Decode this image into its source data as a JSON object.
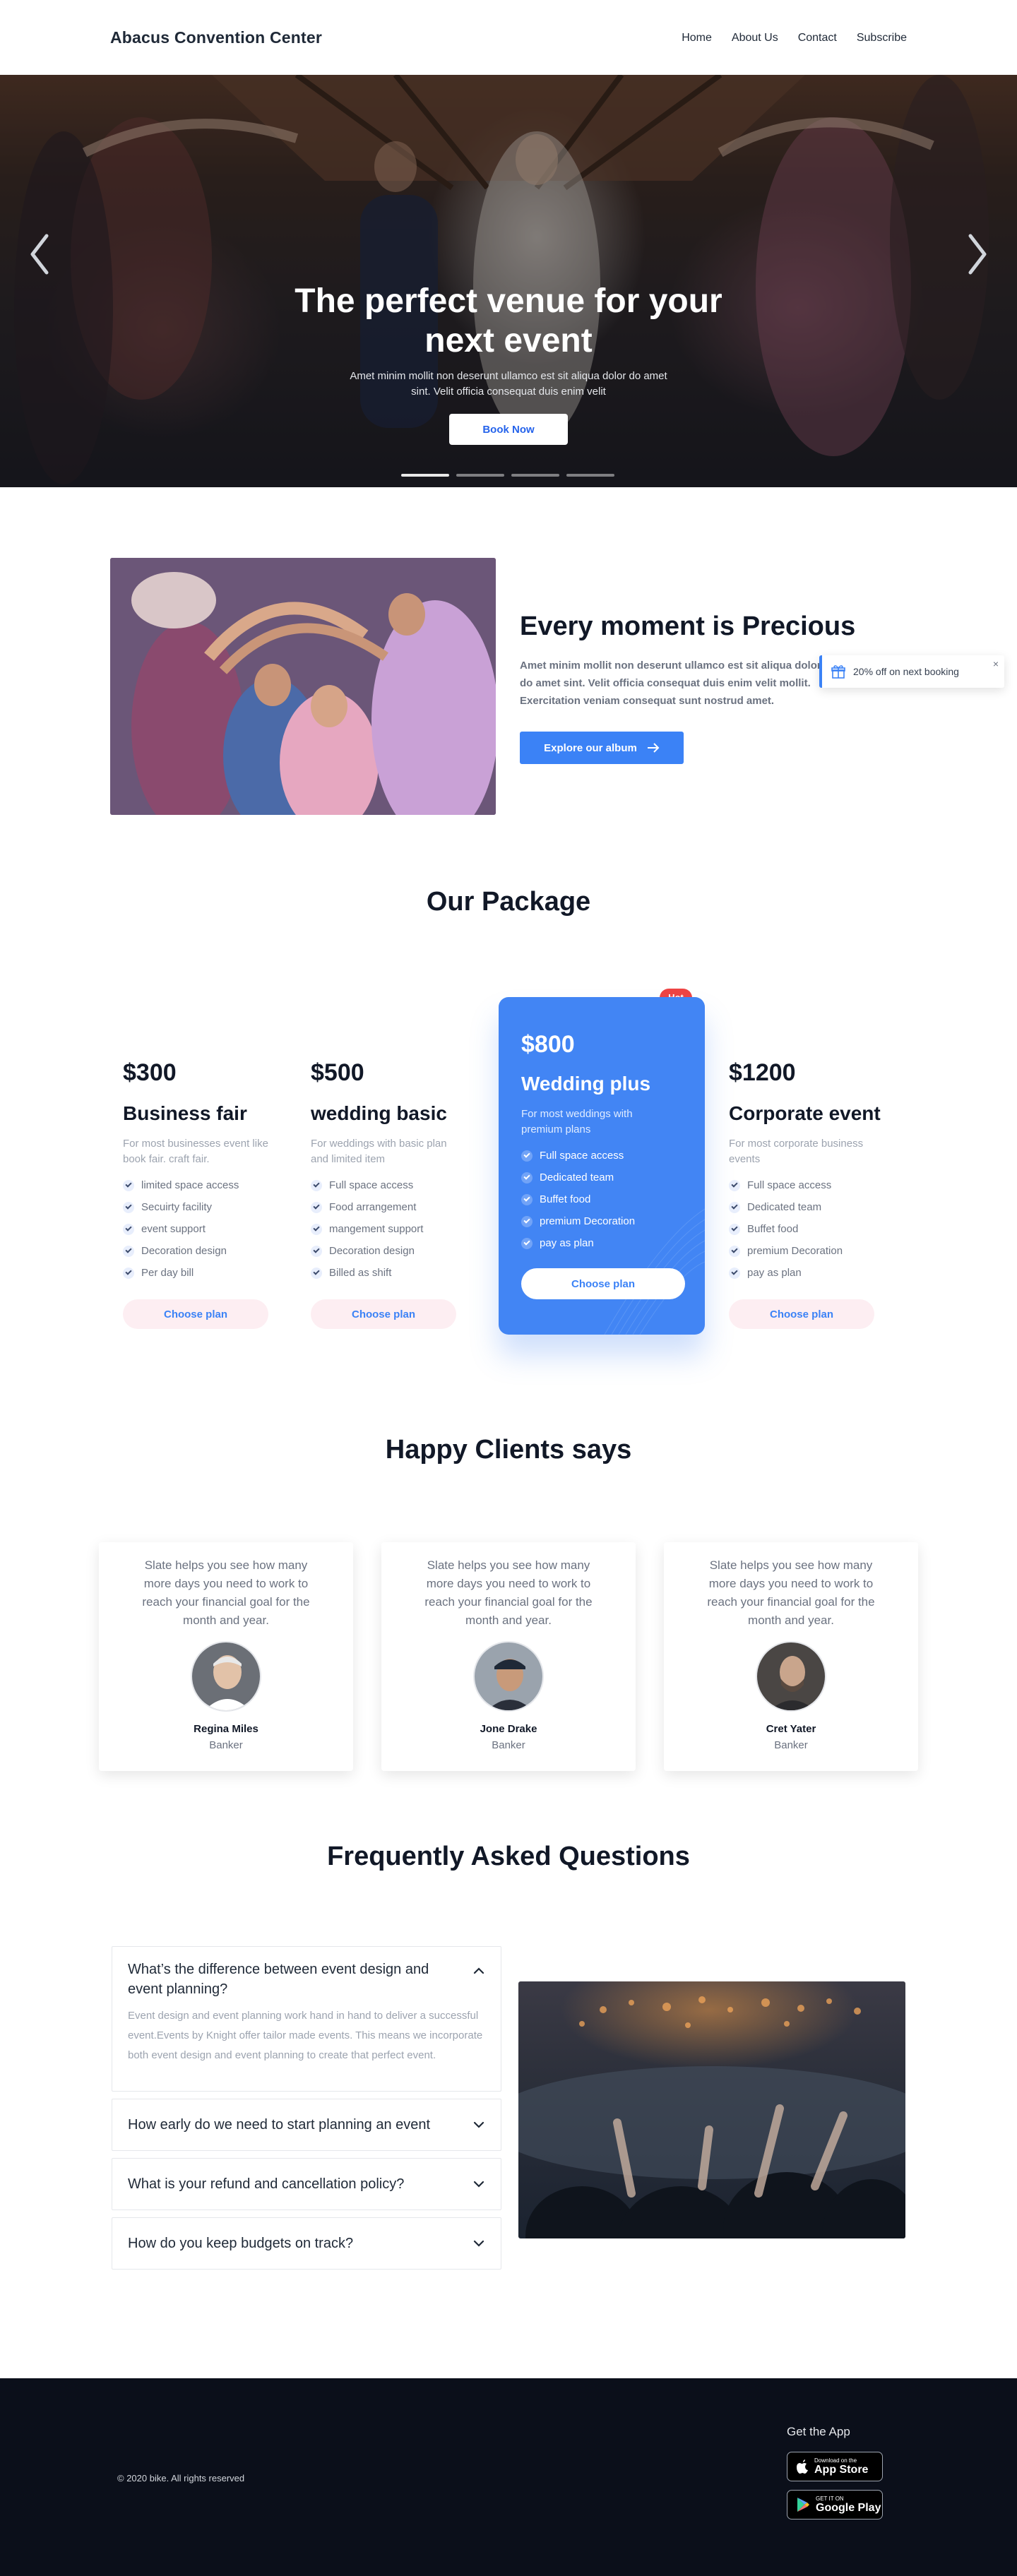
{
  "header": {
    "brand": "Abacus Convention Center",
    "nav": [
      "Home",
      "About Us",
      "Contact",
      "Subscribe"
    ]
  },
  "hero": {
    "title": "The perfect venue for your next event",
    "subtitle": "Amet minim mollit non deserunt ullamco est sit aliqua dolor do amet sint. Velit officia consequat duis enim velit",
    "cta": "Book Now",
    "slides": 4,
    "active_slide": 1
  },
  "precious": {
    "title": "Every moment is Precious",
    "text": "Amet minim mollit non deserunt ullamco est sit aliqua dolor do amet sint. Velit officia consequat duis enim velit mollit. Exercitation veniam consequat sunt nostrud amet.",
    "cta": "Explore our album"
  },
  "promo": {
    "text": "20% off on next booking",
    "close": "×"
  },
  "packages": {
    "title": "Our Package",
    "hot_badge": "Hot",
    "plans": [
      {
        "price": "$300",
        "name": "Business fair",
        "desc": "For most businesses event like book fair. craft fair.",
        "features": [
          "limited space access",
          "Secuirty facility",
          "event support",
          "Decoration design",
          "Per day bill"
        ],
        "cta": "Choose plan"
      },
      {
        "price": "$500",
        "name": "wedding basic",
        "desc": "For weddings with basic plan and limited item",
        "features": [
          "Full space access",
          "Food arrangement",
          "mangement support",
          "Decoration design",
          "Billed as shift"
        ],
        "cta": "Choose plan"
      },
      {
        "price": "$800",
        "name": "Wedding plus",
        "desc": "For most weddings with premium plans",
        "features": [
          "Full space access",
          "Dedicated team",
          "Buffet food",
          "premium Decoration",
          "pay as plan"
        ],
        "cta": "Choose plan"
      },
      {
        "price": "$1200",
        "name": "Corporate event",
        "desc": "For most corporate business events",
        "features": [
          "Full space access",
          "Dedicated team",
          "Buffet food",
          "premium Decoration",
          "pay as plan"
        ],
        "cta": "Choose plan"
      }
    ]
  },
  "testimonials": {
    "title": "Happy Clients says",
    "items": [
      {
        "quote": "Slate helps you see how many more days you need to work to reach your financial goal for the month and year.",
        "name": "Regina Miles",
        "role": "Banker"
      },
      {
        "quote": "Slate helps you see how many more days you need to work to reach your financial goal for the month and year.",
        "name": "Jone Drake",
        "role": "Banker"
      },
      {
        "quote": "Slate helps you see how many more days you need to work to reach your financial goal for the month and year.",
        "name": "Cret Yater",
        "role": "Banker"
      }
    ]
  },
  "faq": {
    "title": "Frequently Asked Questions",
    "items": [
      {
        "q": "What’s the difference between event design and event planning?",
        "a": "Event design and event planning work hand in hand to deliver a successful event.Events by Knight offer tailor made events. This means we incorporate both event design and event planning to create that perfect event.",
        "open": true
      },
      {
        "q": "How early do we need to start planning an event",
        "open": false
      },
      {
        "q": "What is your refund and cancellation policy?",
        "open": false
      },
      {
        "q": "How do you keep budgets on track?",
        "open": false
      }
    ]
  },
  "footer": {
    "copyright": "© 2020 bike. All rights reserved",
    "get_app": "Get the App",
    "app_store": {
      "small": "Download on the",
      "big": "App Store"
    },
    "google_play": {
      "small": "GET IT ON",
      "big": "Google Play"
    }
  },
  "colors": {
    "accent": "#3b82f6",
    "featured": "#4285f4",
    "hot": "#ef4444",
    "footer_bg": "#0b0f1a"
  }
}
